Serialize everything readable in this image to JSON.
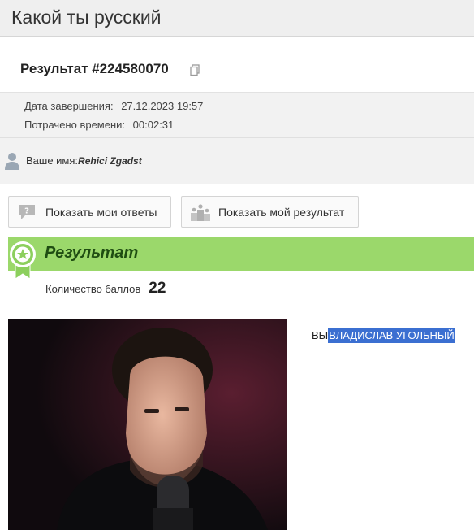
{
  "window": {
    "title": "Какой ты русский"
  },
  "result": {
    "title": "Результат #224580070",
    "copy_icon": "copy-icon"
  },
  "meta": {
    "finished_label": "Дата завершения:",
    "finished_value": "27.12.2023 19:57",
    "time_label": "Потрачено времени:",
    "time_value": "00:02:31"
  },
  "user": {
    "label": "Ваше имя:",
    "name": "Rehici Zgadst",
    "icon": "user-icon"
  },
  "buttons": {
    "answers_label": "Показать мои ответы",
    "answers_icon": "question-bubble-icon",
    "result_label": "Показать мой результат",
    "result_icon": "podium-icon"
  },
  "section": {
    "title": "Результат",
    "badge_icon": "award-badge-icon",
    "accent": "#9bd86b"
  },
  "score": {
    "label": "Количество баллов",
    "value": "22"
  },
  "outcome": {
    "prefix": "ВЫ",
    "highlighted": "ВЛАДИСЛАВ УГОЛЬНЫЙ",
    "highlight_color": "#3b6fd1"
  },
  "photo": {
    "subject": "portrait-photo"
  }
}
